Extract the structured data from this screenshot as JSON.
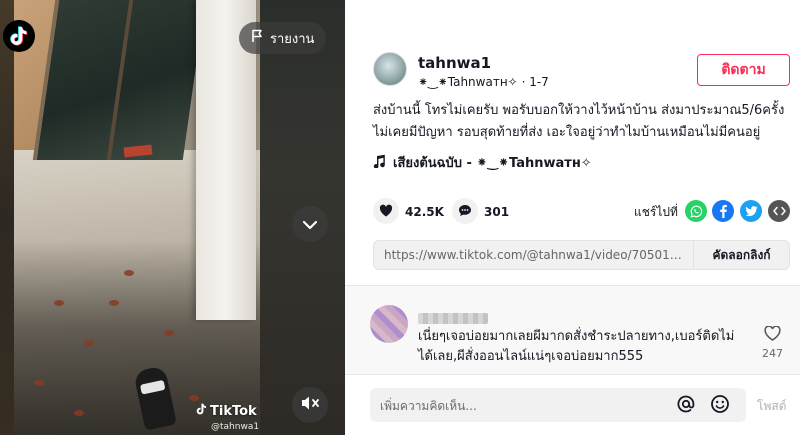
{
  "video": {
    "report_label": "รายงาน",
    "watermark_brand": "TikTok",
    "watermark_user": "@tahnwa1"
  },
  "author": {
    "username": "tahnwa1",
    "nickname": "⁕‿⁕Tahnwaтн✧",
    "separator": "·",
    "date": "1-7",
    "follow_label": "ติดตาม"
  },
  "caption": {
    "line1": "ส่งบ้านนี้ โทรไม่เคยรับ พอรับบอกให้วางไว้หน้าบ้าน ส่งมาประมาณ5/6ครั้ง",
    "line2": "ไม่เคยมีปัญหา รอบสุดท้ายที่ส่ง เอะใจอยู่ว่าทำไมบ้านเหมือนไม่มีคนอยู่"
  },
  "music": {
    "title": "เสียงต้นฉบับ - ⁕‿⁕Tahnwaтн✧"
  },
  "actions": {
    "likes": "42.5K",
    "comments": "301",
    "share_label": "แชร์ไปที่"
  },
  "link": {
    "url": "https://www.tiktok.com/@tahnwa1/video/705018925658...",
    "copy_label": "คัดลอกลิงก์"
  },
  "comment": {
    "text_line1": "เนี่ยๆเจอบ่อยมากเลยผีมากดสั่งชำระปลายทาง,เบอร์ติดไม่",
    "text_line2": "ได้เลย,ผีสั่งออนไลน์แน่ๆเจอบ่อยมาก555",
    "likes": "247"
  },
  "comment_input": {
    "placeholder": "เพิ่มความคิดเห็น...",
    "post_label": "โพสต์"
  },
  "colors": {
    "accent": "#fe2c55",
    "whatsapp": "#25d366",
    "facebook": "#1877f2",
    "twitter": "#1da1f2",
    "embed": "#555555"
  },
  "icons": {
    "logo": "tiktok-logo-icon",
    "report": "flag-icon",
    "next": "chevron-down-icon",
    "mute": "mute-icon",
    "music": "music-note-icon",
    "like": "heart-icon",
    "comment": "comment-bubble-icon",
    "share_whatsapp": "whatsapp-icon",
    "share_facebook": "facebook-icon",
    "share_twitter": "twitter-icon",
    "share_embed": "embed-icon",
    "comment_like": "heart-outline-icon",
    "mention": "at-icon",
    "emoji": "emoji-icon"
  }
}
